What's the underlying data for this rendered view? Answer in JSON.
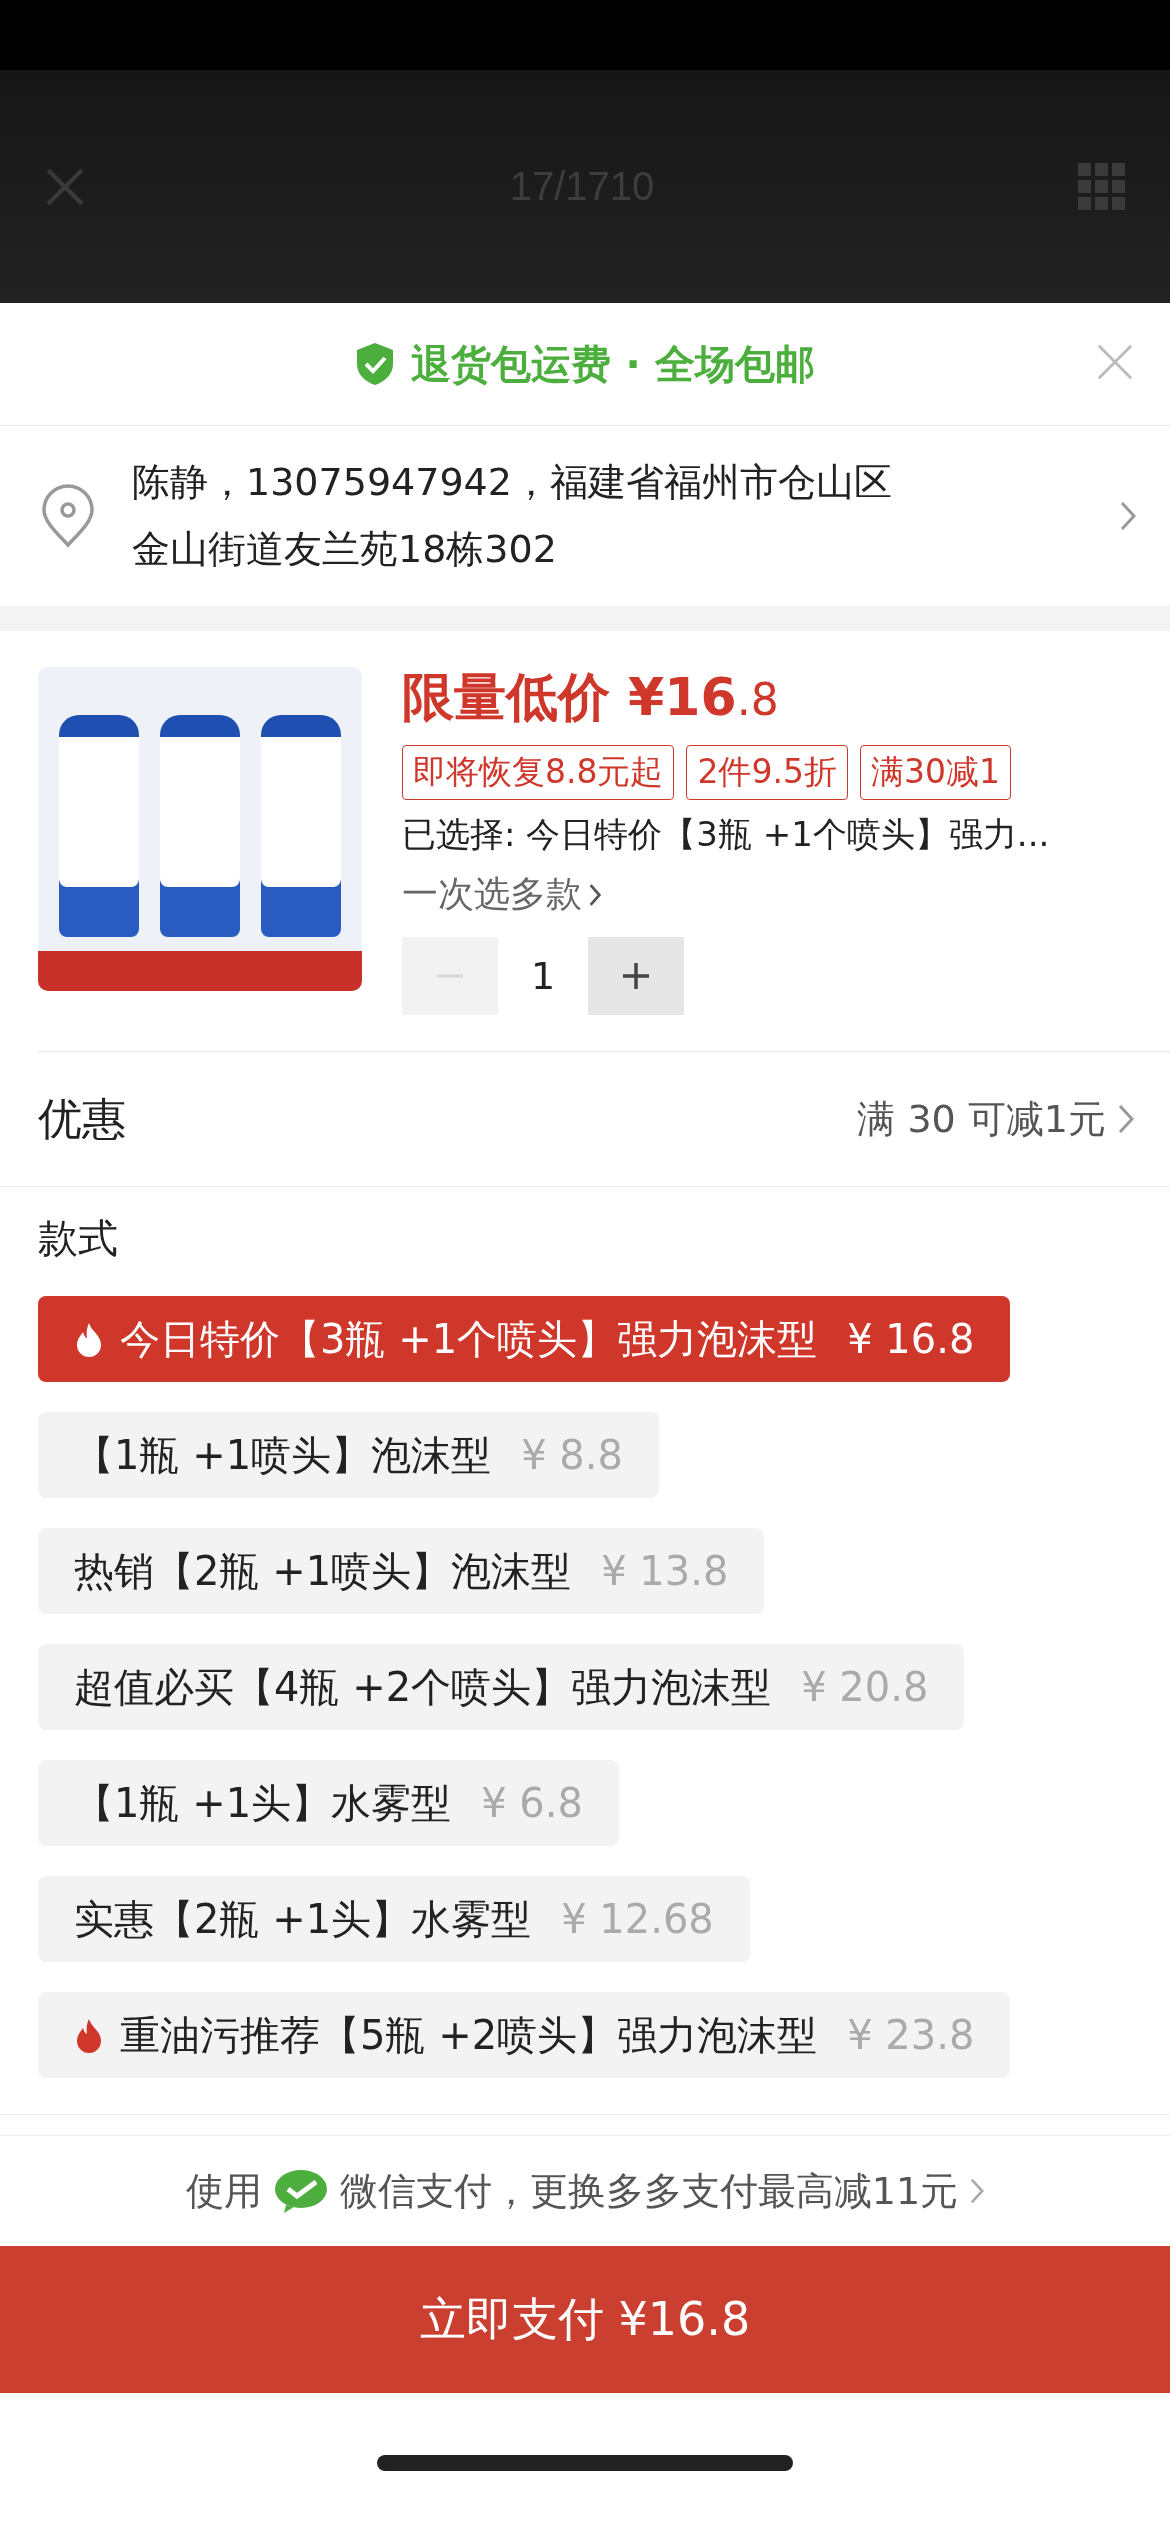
{
  "backdrop": {
    "counter": "17/1710"
  },
  "banner": {
    "text": "退货包运费 · 全场包邮"
  },
  "address": {
    "line1": "陈静，13075947942，福建省福州市仓山区",
    "line2": "金山街道友兰苑18栋302"
  },
  "product": {
    "price_label": "限量低价",
    "price": "¥16",
    "price_decimal": ".8",
    "tags": [
      "即将恢复8.8元起",
      "2件9.5折",
      "满30减1"
    ],
    "selected_text": "已选择: 今日特价【3瓶 +1个喷头】强力...",
    "multi_link": "一次选多款",
    "quantity": {
      "value": "1",
      "minus_disabled": true,
      "plus_disabled": false
    }
  },
  "discount": {
    "label": "优惠",
    "value": "满 30 可减1元"
  },
  "styles": {
    "label": "款式",
    "options": [
      {
        "label": "今日特价【3瓶 +1个喷头】强力泡沫型",
        "price": "¥ 16.8",
        "selected": true,
        "hot": true
      },
      {
        "label": "【1瓶 +1喷头】泡沫型",
        "price": "¥ 8.8",
        "selected": false,
        "hot": false
      },
      {
        "label": "热销【2瓶 +1喷头】泡沫型",
        "price": "¥ 13.8",
        "selected": false,
        "hot": false
      },
      {
        "label": "超值必买【4瓶 +2个喷头】强力泡沫型",
        "price": "¥ 20.8",
        "selected": false,
        "hot": false
      },
      {
        "label": "【1瓶 +1头】水雾型",
        "price": "¥ 6.8",
        "selected": false,
        "hot": false
      },
      {
        "label": "实惠【2瓶 +1头】水雾型",
        "price": "¥ 12.68",
        "selected": false,
        "hot": false
      },
      {
        "label": "重油污推荐【5瓶 +2喷头】强力泡沫型",
        "price": "¥ 23.8",
        "selected": false,
        "hot": true
      }
    ]
  },
  "payment": {
    "prefix": "使用",
    "method": "微信支付，更换多多支付最高减11元"
  },
  "pay_button": {
    "label": "立即支付 ¥16.8"
  }
}
